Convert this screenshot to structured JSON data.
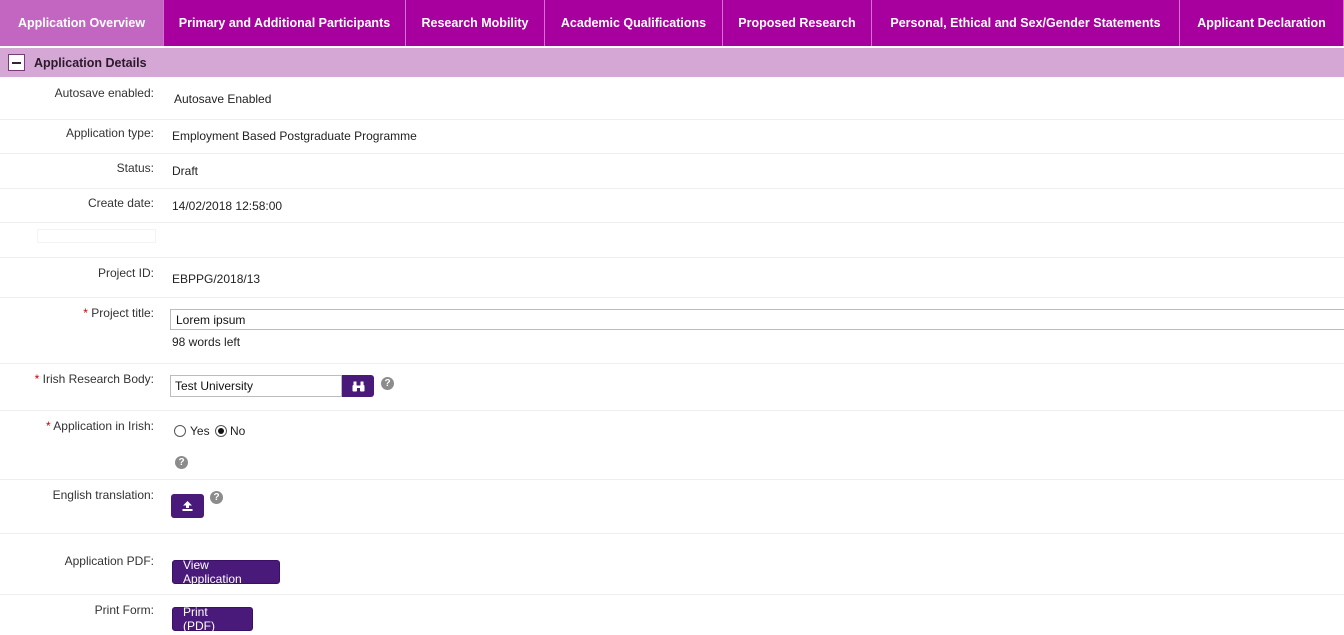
{
  "tabs": [
    {
      "label": "Application Overview",
      "active": true
    },
    {
      "label": "Primary and Additional Participants",
      "active": false
    },
    {
      "label": "Research Mobility",
      "active": false
    },
    {
      "label": "Academic Qualifications",
      "active": false
    },
    {
      "label": "Proposed Research",
      "active": false
    },
    {
      "label": "Personal, Ethical and Sex/Gender Statements",
      "active": false
    },
    {
      "label": "Applicant Declaration",
      "active": false
    }
  ],
  "section": {
    "title": "Application Details"
  },
  "fields": {
    "autosave": {
      "label": "Autosave enabled:",
      "value": "Autosave Enabled"
    },
    "application_type": {
      "label": "Application type:",
      "value": "Employment Based Postgraduate Programme"
    },
    "status": {
      "label": "Status:",
      "value": "Draft"
    },
    "create_date": {
      "label": "Create date:",
      "value": "14/02/2018 12:58:00"
    },
    "project_id": {
      "label": "Project ID:",
      "value": "EBPPG/2018/13"
    },
    "project_title": {
      "required_mark": "*",
      "label": " Project title:",
      "value": "Lorem ipsum",
      "words_left": "98 words left"
    },
    "research_body": {
      "required_mark": "*",
      "label": " Irish Research Body:",
      "value": "Test University"
    },
    "application_in_irish": {
      "required_mark": "*",
      "label": " Application in Irish:",
      "options": [
        "Yes",
        "No"
      ],
      "selected": "No"
    },
    "english_translation": {
      "label": "English translation:"
    },
    "application_pdf": {
      "label": "Application PDF:",
      "button": "View Application"
    },
    "print_form": {
      "label": "Print Form:",
      "button": "Print (PDF)"
    }
  },
  "colors": {
    "tab_bar": "#a8009e",
    "tab_active": "#c266c2",
    "section_header": "#d5a7d5",
    "button": "#4a1a7a",
    "required": "#cc0000"
  },
  "icons": {
    "search": "binoculars-icon",
    "help": "question-icon",
    "upload": "upload-icon",
    "collapse": "minus-icon"
  }
}
